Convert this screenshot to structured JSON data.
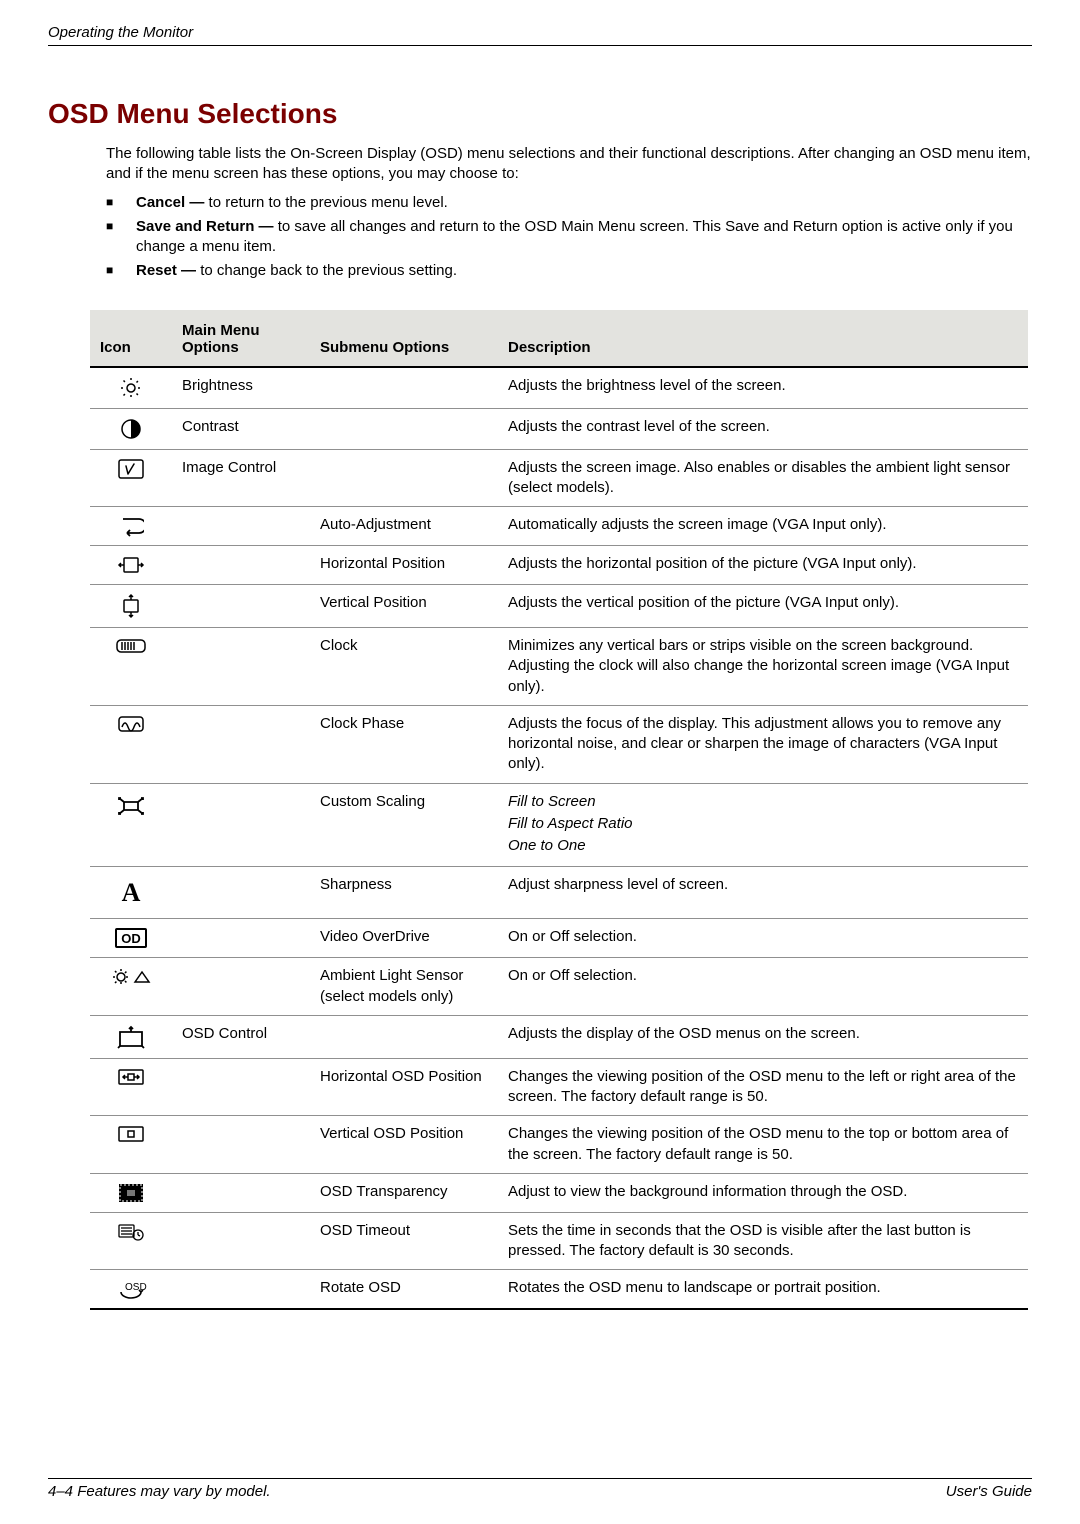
{
  "running_head": "Operating the Monitor",
  "title": "OSD Menu Selections",
  "intro": "The following table lists the On-Screen Display (OSD) menu selections and their functional descriptions. After changing an OSD menu item, and if the menu screen has these options, you may choose to:",
  "options": [
    {
      "label": "Cancel —",
      "text": " to return to the previous menu level."
    },
    {
      "label": "Save and Return —",
      "text": " to save all changes and return to the OSD Main Menu screen. This Save and Return option is active only if you change a menu item."
    },
    {
      "label": "Reset —",
      "text": " to change back to the previous setting."
    }
  ],
  "headers": {
    "icon": "Icon",
    "main_line1": "Main Menu",
    "main_line2": "Options",
    "sub": "Submenu Options",
    "desc": "Description"
  },
  "rows": [
    {
      "icon": "brightness",
      "main": "Brightness",
      "sub": "",
      "desc": "Adjusts the brightness level of the screen."
    },
    {
      "icon": "contrast",
      "main": "Contrast",
      "sub": "",
      "desc": "Adjusts the contrast level of the screen."
    },
    {
      "icon": "image-ctl",
      "main": "Image Control",
      "sub": "",
      "desc": "Adjusts the screen image. Also enables or disables the ambient light sensor (select models)."
    },
    {
      "icon": "auto-adj",
      "main": "",
      "sub": "Auto-Adjustment",
      "desc": "Automatically adjusts the screen image (VGA Input only)."
    },
    {
      "icon": "hpos",
      "main": "",
      "sub": "Horizontal Position",
      "desc": "Adjusts the horizontal position of the picture (VGA Input only)."
    },
    {
      "icon": "vpos",
      "main": "",
      "sub": "Vertical Position",
      "desc": "Adjusts the vertical position of the picture (VGA Input only)."
    },
    {
      "icon": "clock",
      "main": "",
      "sub": "Clock",
      "desc": "Minimizes any vertical bars or strips visible on the screen background. Adjusting the clock will also change the horizontal screen image (VGA Input only)."
    },
    {
      "icon": "clockphase",
      "main": "",
      "sub": "Clock Phase",
      "desc": "Adjusts the focus of the display. This adjustment allows you to remove any horizontal noise, and clear or sharpen the image of characters (VGA Input only)."
    },
    {
      "icon": "customscale",
      "main": "",
      "sub": "Custom Scaling",
      "desc_custom": true,
      "d1": "Fill to Screen",
      "d2": "Fill to Aspect Ratio",
      "d3": "One to One"
    },
    {
      "icon": "sharpness",
      "main": "",
      "sub": "Sharpness",
      "desc": "Adjust sharpness level of screen."
    },
    {
      "icon": "overdrive",
      "main": "",
      "sub": "Video OverDrive",
      "desc": "On or Off selection."
    },
    {
      "icon": "als",
      "main": "",
      "sub": "Ambient Light Sensor (select models only)",
      "desc": "On or Off selection."
    },
    {
      "icon": "osdctl",
      "main": "OSD Control",
      "sub": "",
      "desc": "Adjusts the display of the OSD menus on the screen."
    },
    {
      "icon": "osdhpos",
      "main": "",
      "sub": "Horizontal OSD Position",
      "desc": "Changes the viewing position of the OSD menu to the left or right area of the screen. The factory default range is 50."
    },
    {
      "icon": "osdvpos",
      "main": "",
      "sub": "Vertical OSD Position",
      "desc": "Changes the viewing position of the OSD menu to the top or bottom area of the screen. The factory default range is 50."
    },
    {
      "icon": "osdtrans",
      "main": "",
      "sub": "OSD Transparency",
      "desc": "Adjust to view the background information through the OSD."
    },
    {
      "icon": "osdtimeout",
      "main": "",
      "sub": "OSD Timeout",
      "desc": "Sets the time in seconds that the OSD is visible after the last button is pressed. The factory default is 30 seconds."
    },
    {
      "icon": "rotateosd",
      "main": "",
      "sub": "Rotate OSD",
      "desc": "Rotates the OSD menu to landscape or portrait position."
    }
  ],
  "footer_left": "4–4 Features may vary by model.",
  "footer_right": "User's Guide"
}
